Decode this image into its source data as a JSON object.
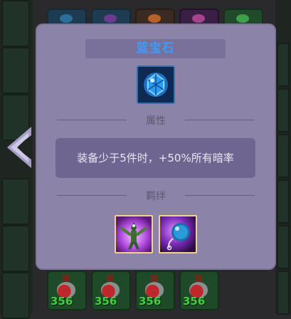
{
  "tooltip": {
    "item_name": "蓝宝石",
    "item_icon": "sapphire-icon",
    "attributes_header": "属性",
    "attribute_text": "装备少于5件时，+50%所有暗率",
    "bonds_header": "羁绊",
    "bond_icons": [
      "wood-golem-icon",
      "bomb-icon"
    ]
  },
  "inventory": {
    "potion_counts": [
      "356",
      "356",
      "356",
      "356"
    ]
  },
  "colors": {
    "title": "#3d9bff",
    "panel": "#8c83a8",
    "potion_count": "#3fd03f"
  }
}
